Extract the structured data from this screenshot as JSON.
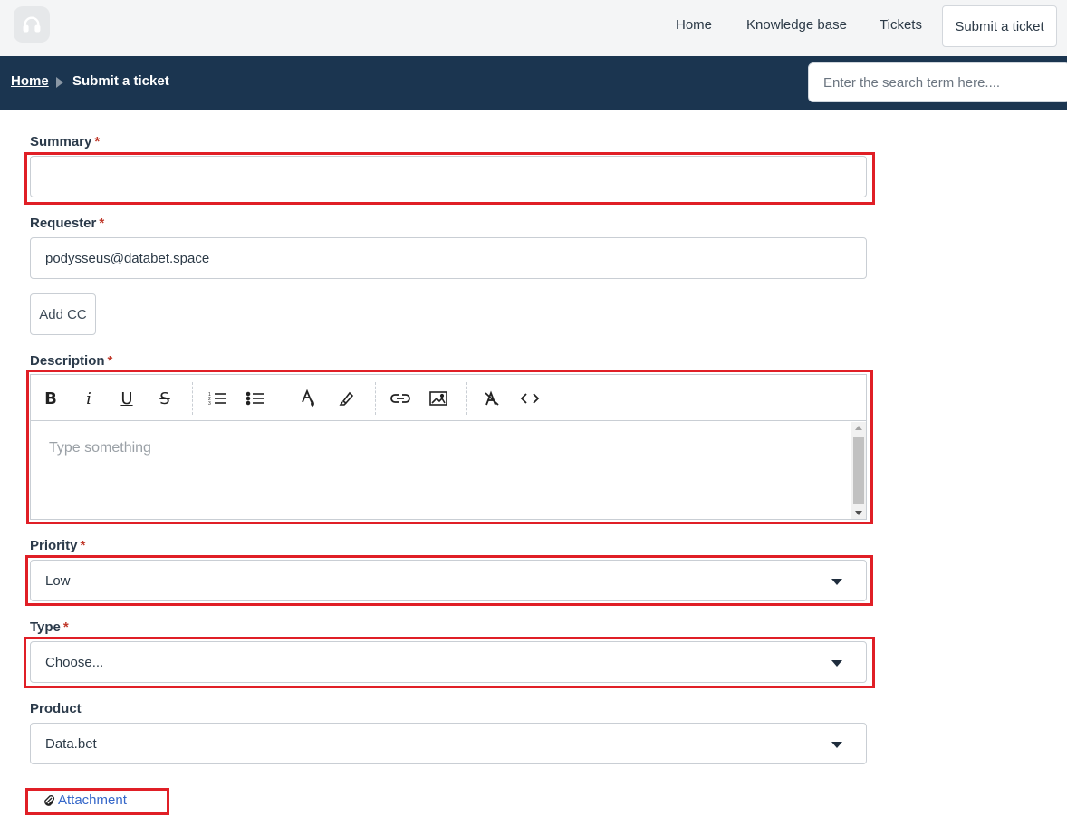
{
  "nav": {
    "logo_icon": "headset-icon",
    "home": "Home",
    "knowledge_base": "Knowledge base",
    "tickets": "Tickets",
    "submit_ticket": "Submit a ticket"
  },
  "breadcrumb": {
    "home": "Home",
    "current": "Submit a ticket"
  },
  "search": {
    "placeholder": "Enter the search term here...."
  },
  "form": {
    "summary": {
      "label": "Summary",
      "required": "*",
      "value": ""
    },
    "requester": {
      "label": "Requester",
      "required": "*",
      "value": "podysseus@databet.space"
    },
    "add_cc": "Add CC",
    "description": {
      "label": "Description",
      "required": "*",
      "placeholder": "Type something"
    },
    "priority": {
      "label": "Priority",
      "required": "*",
      "value": "Low"
    },
    "type": {
      "label": "Type",
      "required": "*",
      "value": "Choose..."
    },
    "product": {
      "label": "Product",
      "value": "Data.bet"
    },
    "attachment": "Attachment"
  },
  "toolbar": {
    "buttons": [
      "bold-icon",
      "italic-icon",
      "underline-icon",
      "strikethrough-icon",
      "ordered-list-icon",
      "unordered-list-icon",
      "text-color-icon",
      "highlight-icon",
      "link-icon",
      "image-icon",
      "clear-format-icon",
      "code-icon"
    ]
  },
  "colors": {
    "breadcrumb_bg": "#1b3550",
    "highlight": "#e01f26",
    "link": "#3567c9",
    "required": "#c0392b"
  }
}
